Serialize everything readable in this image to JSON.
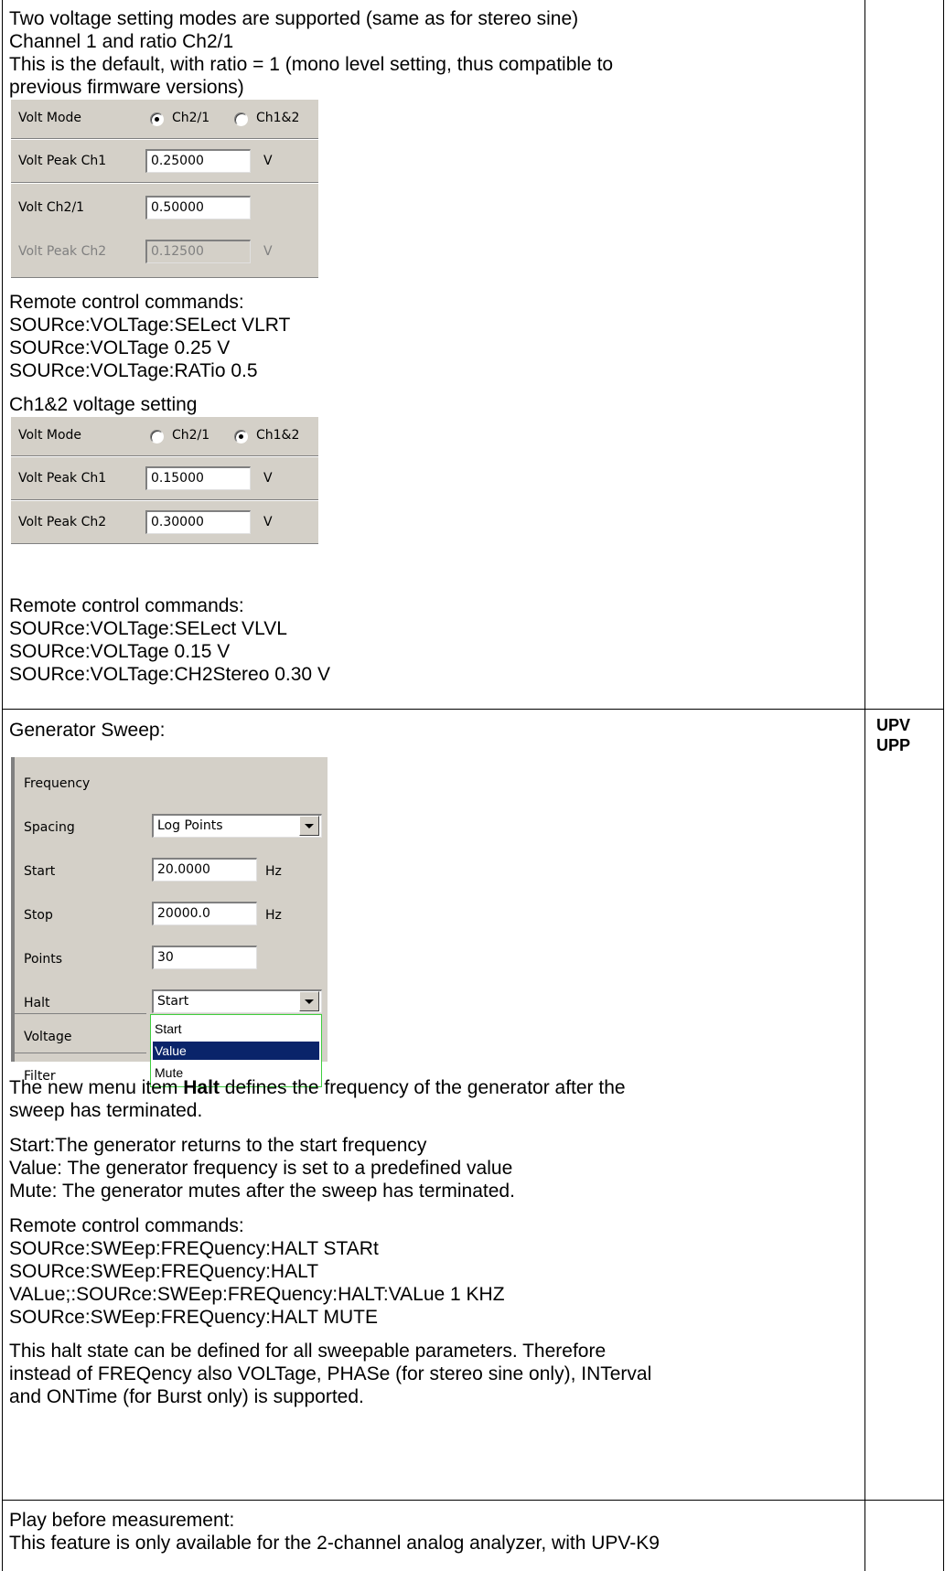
{
  "section1": {
    "para1_lines": [
      "Two voltage setting modes are supported (same as for stereo sine)",
      "Channel 1 and ratio Ch2/1",
      "This is the default, with ratio = 1 (mono level setting, thus compatible to",
      "previous firmware versions)"
    ],
    "panel1": {
      "volt_mode_label": "Volt Mode",
      "radio_ch21": "Ch2/1",
      "radio_ch12": "Ch1&2",
      "volt_peak_ch1_label": "Volt Peak Ch1",
      "volt_peak_ch1_value": "0.25000",
      "volt_peak_ch1_unit": "V",
      "volt_ratio_label": "Volt Ch2/1",
      "volt_ratio_value": "0.50000",
      "volt_peak_ch2_label": "Volt Peak Ch2",
      "volt_peak_ch2_value": "0.12500",
      "volt_peak_ch2_unit": "V"
    },
    "remote1_lines": [
      "Remote control commands:",
      "SOURce:VOLTage:SELect VLRT",
      "SOURce:VOLTage 0.25 V",
      "SOURce:VOLTage:RATio 0.5"
    ],
    "ch12_heading": "Ch1&2 voltage setting",
    "panel2": {
      "volt_mode_label": "Volt Mode",
      "radio_ch21": "Ch2/1",
      "radio_ch12": "Ch1&2",
      "volt_peak_ch1_label": "Volt Peak Ch1",
      "volt_peak_ch1_value": "0.15000",
      "volt_peak_ch1_unit": "V",
      "volt_peak_ch2_label": "Volt Peak Ch2",
      "volt_peak_ch2_value": "0.30000",
      "volt_peak_ch2_unit": "V"
    },
    "remote2_lines": [
      "Remote control commands:",
      "SOURce:VOLTage:SELect VLVL",
      "SOURce:VOLTage 0.15 V",
      "SOURce:VOLTage:CH2Stereo 0.30 V"
    ]
  },
  "section2": {
    "heading": "Generator Sweep:",
    "tag_line1": "UPV",
    "tag_line2": "UPP",
    "panel": {
      "frequency_label": "Frequency",
      "spacing_label": "Spacing",
      "spacing_value": "Log Points",
      "start_label": "Start",
      "start_value": "20.0000",
      "start_unit": "Hz",
      "stop_label": "Stop",
      "stop_value": "20000.0",
      "stop_unit": "Hz",
      "points_label": "Points",
      "points_value": "30",
      "halt_label": "Halt",
      "halt_value": "Start",
      "voltage_label": "Voltage",
      "filter_label": "Filter",
      "halt_options": [
        "Start",
        "Value",
        "Mute"
      ]
    },
    "halt_para_pre": "The new menu item ",
    "halt_para_bold": "Halt",
    "halt_para_post": " defines the frequency of the generator after the",
    "halt_para_line2": "sweep has terminated.",
    "options_lines": [
      "Start:The generator returns to the start frequency",
      "Value: The generator frequency is set to a predefined value",
      "Mute: The generator mutes after the sweep has terminated."
    ],
    "remote_lines": [
      "Remote control commands:",
      "SOURce:SWEep:FREQuency:HALT STARt",
      "SOURce:SWEep:FREQuency:HALT",
      "VALue;:SOURce:SWEep:FREQuency:HALT:VALue 1 KHZ",
      "SOURce:SWEep:FREQuency:HALT MUTE"
    ],
    "final_lines": [
      "This halt state can be defined for all sweepable parameters. Therefore",
      "instead of FREQency also VOLTage, PHASe (for stereo sine only), INTerval",
      "and ONTime (for Burst only) is supported."
    ]
  },
  "section3": {
    "lines": [
      "Play before measurement:",
      "This feature is only available for the 2-channel analog analyzer, with UPV-K9"
    ]
  }
}
